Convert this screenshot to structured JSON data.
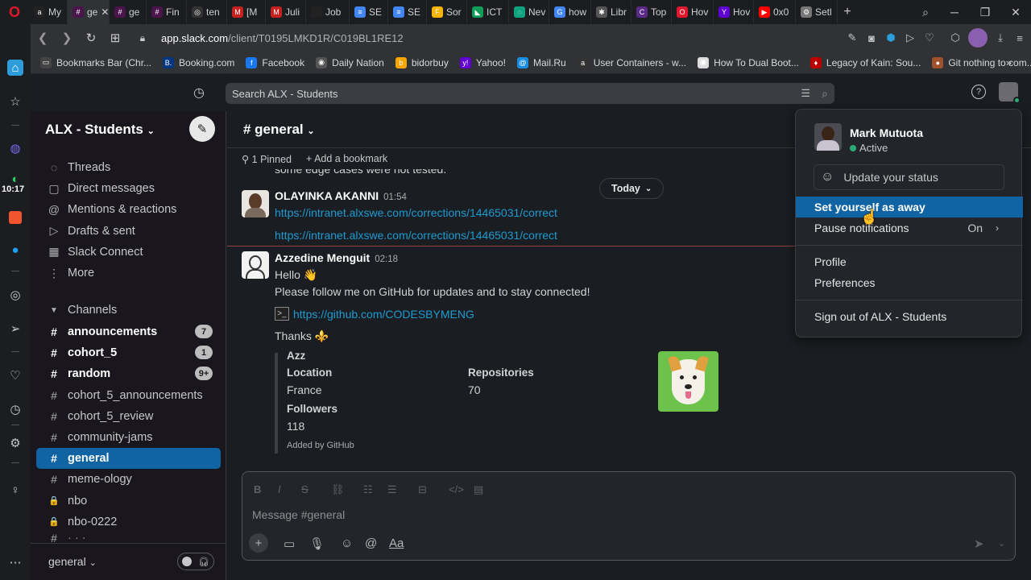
{
  "browser": {
    "tabs": [
      {
        "label": "My",
        "color": "#222",
        "glyph": "a",
        "w": 48
      },
      {
        "label": "ge",
        "color": "#4a154b",
        "glyph": "#",
        "w": 52,
        "active": true
      },
      {
        "label": "ge",
        "color": "#4a154b",
        "glyph": "#",
        "w": 46
      },
      {
        "label": "Fin",
        "color": "#4a154b",
        "glyph": "#",
        "w": 50
      },
      {
        "label": "ten",
        "color": "#333",
        "glyph": "◎",
        "w": 50
      },
      {
        "label": "[M",
        "color": "#c5221f",
        "glyph": "M",
        "w": 48
      },
      {
        "label": "Juli",
        "color": "#c5221f",
        "glyph": "M",
        "w": 50
      },
      {
        "label": "Job",
        "color": "#222",
        "glyph": " ",
        "w": 54
      },
      {
        "label": "SE",
        "color": "#4285f4",
        "glyph": "≡",
        "w": 48
      },
      {
        "label": "SE",
        "color": "#4285f4",
        "glyph": "≡",
        "w": 48
      },
      {
        "label": "Sor",
        "color": "#f4b400",
        "glyph": "F",
        "w": 50
      },
      {
        "label": "ICT",
        "color": "#0f9d58",
        "glyph": "◣",
        "w": 52
      },
      {
        "label": "Nev",
        "color": "#10a37f",
        "glyph": "◌",
        "w": 50
      },
      {
        "label": "how",
        "color": "#4285f4",
        "glyph": "G",
        "w": 52
      },
      {
        "label": "Libr",
        "color": "#555",
        "glyph": "✱",
        "w": 50
      },
      {
        "label": "Top",
        "color": "#5b2a86",
        "glyph": "C",
        "w": 50
      },
      {
        "label": "Hov",
        "color": "#e0182d",
        "glyph": "O",
        "w": 52
      },
      {
        "label": "Hov",
        "color": "#5f01d1",
        "glyph": "Y",
        "w": 50
      },
      {
        "label": "0x0",
        "color": "#ff0000",
        "glyph": "▶",
        "w": 52
      },
      {
        "label": "Setl",
        "color": "#777",
        "glyph": "⚙",
        "w": 52
      }
    ],
    "new_tab": "+",
    "url_host": "app.slack.com",
    "url_path": "/client/T0195LMKD1R/C019BL1RE12",
    "bookmarks": [
      {
        "label": "Bookmarks Bar (Chr...",
        "color": "#444",
        "glyph": "▭"
      },
      {
        "label": "Booking.com",
        "color": "#003580",
        "glyph": "B."
      },
      {
        "label": "Facebook",
        "color": "#1877f2",
        "glyph": "f"
      },
      {
        "label": "Daily Nation",
        "color": "#555",
        "glyph": "◉"
      },
      {
        "label": "bidorbuy",
        "color": "#f7a600",
        "glyph": "b"
      },
      {
        "label": "Yahoo!",
        "color": "#6001d2",
        "glyph": "y!"
      },
      {
        "label": "Mail.Ru",
        "color": "#168de2",
        "glyph": "@"
      },
      {
        "label": "User Containers - w...",
        "color": "#333",
        "glyph": "a"
      },
      {
        "label": "How To Dual Boot...",
        "color": "#ddd",
        "glyph": "▣"
      },
      {
        "label": "Legacy of Kain: Sou...",
        "color": "#b00",
        "glyph": "♦"
      },
      {
        "label": "Git nothing to com...",
        "color": "#a0522d",
        "glyph": "●"
      }
    ],
    "bookmarks_more": "»"
  },
  "opera_sidebar": {
    "clock": "10:17"
  },
  "slack": {
    "search_placeholder": "Search ALX - Students",
    "workspace": "ALX - Students",
    "nav_items": [
      {
        "label": "Threads",
        "icon": "threads-icon",
        "glyph": "◌"
      },
      {
        "label": "Direct messages",
        "icon": "direct-messages-icon",
        "glyph": "▢"
      },
      {
        "label": "Mentions & reactions",
        "icon": "at-icon",
        "glyph": "@"
      },
      {
        "label": "Drafts & sent",
        "icon": "send-icon",
        "glyph": "▷"
      },
      {
        "label": "Slack Connect",
        "icon": "building-icon",
        "glyph": "▦"
      },
      {
        "label": "More",
        "icon": "more-icon",
        "glyph": "⋮"
      }
    ],
    "channels_heading": "Channels",
    "channels": [
      {
        "name": "announcements",
        "bold": true,
        "badge": "7",
        "icon": "#"
      },
      {
        "name": "cohort_5",
        "bold": true,
        "badge": "1",
        "icon": "#"
      },
      {
        "name": "random",
        "bold": true,
        "badge": "9+",
        "icon": "#"
      },
      {
        "name": "cohort_5_announcements",
        "bold": false,
        "badge": "",
        "icon": "#"
      },
      {
        "name": "cohort_5_review",
        "bold": false,
        "badge": "",
        "icon": "#"
      },
      {
        "name": "community-jams",
        "bold": false,
        "badge": "",
        "icon": "#"
      },
      {
        "name": "general",
        "bold": true,
        "badge": "",
        "icon": "#",
        "active": true
      },
      {
        "name": "meme-ology",
        "bold": false,
        "badge": "",
        "icon": "#"
      },
      {
        "name": "nbo",
        "bold": false,
        "badge": "",
        "icon": "🔒"
      },
      {
        "name": "nbo-0222",
        "bold": false,
        "badge": "",
        "icon": "🔒"
      }
    ],
    "huddle_label": "general",
    "channel": {
      "title": "# general",
      "pinned": "1 Pinned",
      "add_bookmark": "Add a bookmark",
      "prev_text": "some edge cases were not tested.",
      "today": "Today",
      "messages": [
        {
          "author": "OLAYINKA AKANNI",
          "time": "01:54",
          "links": [
            "https://intranet.alxswe.com/corrections/14465031/correct",
            "https://intranet.alxswe.com/corrections/14465031/correct"
          ]
        },
        {
          "author": "Azzedine Menguit",
          "time": "02:18",
          "hello": "Hello 👋",
          "line": "Please follow me on GitHub for updates and to stay connected!",
          "gh_link": "https://github.com/CODESBYMENG",
          "thanks": "Thanks ⚜️",
          "attachment": {
            "name": "Azz",
            "location_label": "Location",
            "location": "France",
            "repos_label": "Repositories",
            "repos": "70",
            "followers_label": "Followers",
            "followers": "118",
            "footer": "Added by GitHub"
          }
        }
      ],
      "composer_placeholder": "Message #general"
    },
    "user_menu": {
      "name": "Mark Mutuota",
      "status": "Active",
      "update_status": "Update your status",
      "away": "Set yourself as away",
      "pause": "Pause notifications",
      "pause_state": "On",
      "profile": "Profile",
      "preferences": "Preferences",
      "sign_out": "Sign out of ALX - Students"
    }
  }
}
